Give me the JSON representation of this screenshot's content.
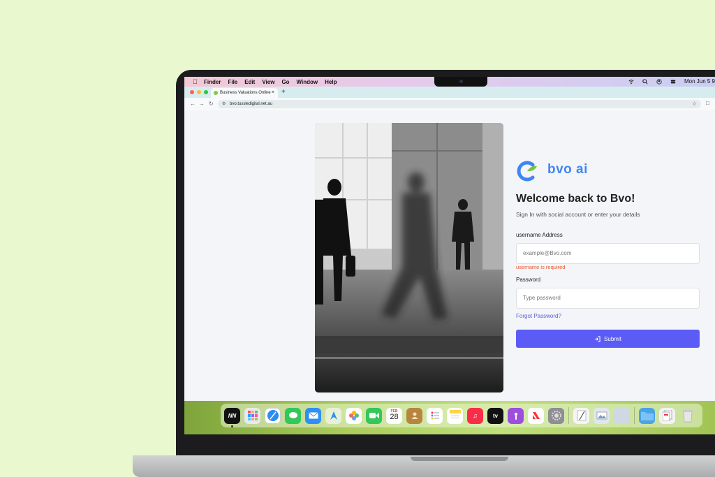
{
  "menubar": {
    "app": "Finder",
    "menus": [
      "File",
      "Edit",
      "View",
      "Go",
      "Window",
      "Help"
    ],
    "datetime": "Mon Jun 5  9"
  },
  "browser": {
    "tab_title": "Business Valuations Online",
    "url": "bvo.tussledigital.net.au"
  },
  "login": {
    "brand": "bvo ai",
    "heading": "Welcome back to Bvo!",
    "subheading": "Sign In with social account or enter your details",
    "username_label": "username Address",
    "username_placeholder": "example@Bvo.com",
    "username_error": "username is required",
    "password_label": "Password",
    "password_placeholder": "Type password",
    "forgot": "Forgot Password?",
    "submit": "Submit"
  },
  "dock": {
    "calendar_month": "FEB",
    "calendar_day": "28",
    "appletv": "tv"
  },
  "colors": {
    "accent": "#5b5bf5",
    "brand_blue": "#3f86f2",
    "error": "#e4572e",
    "background": "#eaf8cf"
  }
}
